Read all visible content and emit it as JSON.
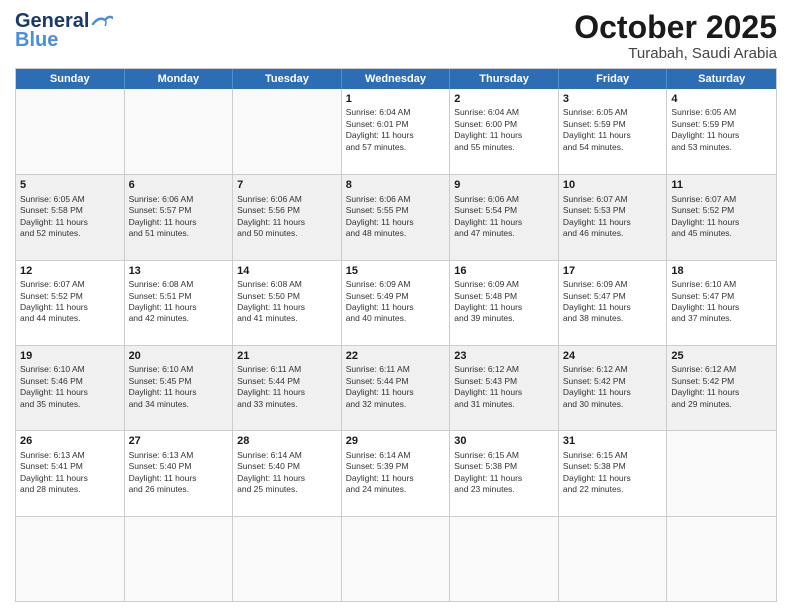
{
  "header": {
    "logo_line1": "General",
    "logo_line2": "Blue",
    "month": "October 2025",
    "location": "Turabah, Saudi Arabia"
  },
  "weekdays": [
    "Sunday",
    "Monday",
    "Tuesday",
    "Wednesday",
    "Thursday",
    "Friday",
    "Saturday"
  ],
  "rows": [
    [
      {
        "day": "",
        "text": ""
      },
      {
        "day": "",
        "text": ""
      },
      {
        "day": "",
        "text": ""
      },
      {
        "day": "1",
        "text": "Sunrise: 6:04 AM\nSunset: 6:01 PM\nDaylight: 11 hours\nand 57 minutes."
      },
      {
        "day": "2",
        "text": "Sunrise: 6:04 AM\nSunset: 6:00 PM\nDaylight: 11 hours\nand 55 minutes."
      },
      {
        "day": "3",
        "text": "Sunrise: 6:05 AM\nSunset: 5:59 PM\nDaylight: 11 hours\nand 54 minutes."
      },
      {
        "day": "4",
        "text": "Sunrise: 6:05 AM\nSunset: 5:59 PM\nDaylight: 11 hours\nand 53 minutes."
      }
    ],
    [
      {
        "day": "5",
        "text": "Sunrise: 6:05 AM\nSunset: 5:58 PM\nDaylight: 11 hours\nand 52 minutes."
      },
      {
        "day": "6",
        "text": "Sunrise: 6:06 AM\nSunset: 5:57 PM\nDaylight: 11 hours\nand 51 minutes."
      },
      {
        "day": "7",
        "text": "Sunrise: 6:06 AM\nSunset: 5:56 PM\nDaylight: 11 hours\nand 50 minutes."
      },
      {
        "day": "8",
        "text": "Sunrise: 6:06 AM\nSunset: 5:55 PM\nDaylight: 11 hours\nand 48 minutes."
      },
      {
        "day": "9",
        "text": "Sunrise: 6:06 AM\nSunset: 5:54 PM\nDaylight: 11 hours\nand 47 minutes."
      },
      {
        "day": "10",
        "text": "Sunrise: 6:07 AM\nSunset: 5:53 PM\nDaylight: 11 hours\nand 46 minutes."
      },
      {
        "day": "11",
        "text": "Sunrise: 6:07 AM\nSunset: 5:52 PM\nDaylight: 11 hours\nand 45 minutes."
      }
    ],
    [
      {
        "day": "12",
        "text": "Sunrise: 6:07 AM\nSunset: 5:52 PM\nDaylight: 11 hours\nand 44 minutes."
      },
      {
        "day": "13",
        "text": "Sunrise: 6:08 AM\nSunset: 5:51 PM\nDaylight: 11 hours\nand 42 minutes."
      },
      {
        "day": "14",
        "text": "Sunrise: 6:08 AM\nSunset: 5:50 PM\nDaylight: 11 hours\nand 41 minutes."
      },
      {
        "day": "15",
        "text": "Sunrise: 6:09 AM\nSunset: 5:49 PM\nDaylight: 11 hours\nand 40 minutes."
      },
      {
        "day": "16",
        "text": "Sunrise: 6:09 AM\nSunset: 5:48 PM\nDaylight: 11 hours\nand 39 minutes."
      },
      {
        "day": "17",
        "text": "Sunrise: 6:09 AM\nSunset: 5:47 PM\nDaylight: 11 hours\nand 38 minutes."
      },
      {
        "day": "18",
        "text": "Sunrise: 6:10 AM\nSunset: 5:47 PM\nDaylight: 11 hours\nand 37 minutes."
      }
    ],
    [
      {
        "day": "19",
        "text": "Sunrise: 6:10 AM\nSunset: 5:46 PM\nDaylight: 11 hours\nand 35 minutes."
      },
      {
        "day": "20",
        "text": "Sunrise: 6:10 AM\nSunset: 5:45 PM\nDaylight: 11 hours\nand 34 minutes."
      },
      {
        "day": "21",
        "text": "Sunrise: 6:11 AM\nSunset: 5:44 PM\nDaylight: 11 hours\nand 33 minutes."
      },
      {
        "day": "22",
        "text": "Sunrise: 6:11 AM\nSunset: 5:44 PM\nDaylight: 11 hours\nand 32 minutes."
      },
      {
        "day": "23",
        "text": "Sunrise: 6:12 AM\nSunset: 5:43 PM\nDaylight: 11 hours\nand 31 minutes."
      },
      {
        "day": "24",
        "text": "Sunrise: 6:12 AM\nSunset: 5:42 PM\nDaylight: 11 hours\nand 30 minutes."
      },
      {
        "day": "25",
        "text": "Sunrise: 6:12 AM\nSunset: 5:42 PM\nDaylight: 11 hours\nand 29 minutes."
      }
    ],
    [
      {
        "day": "26",
        "text": "Sunrise: 6:13 AM\nSunset: 5:41 PM\nDaylight: 11 hours\nand 28 minutes."
      },
      {
        "day": "27",
        "text": "Sunrise: 6:13 AM\nSunset: 5:40 PM\nDaylight: 11 hours\nand 26 minutes."
      },
      {
        "day": "28",
        "text": "Sunrise: 6:14 AM\nSunset: 5:40 PM\nDaylight: 11 hours\nand 25 minutes."
      },
      {
        "day": "29",
        "text": "Sunrise: 6:14 AM\nSunset: 5:39 PM\nDaylight: 11 hours\nand 24 minutes."
      },
      {
        "day": "30",
        "text": "Sunrise: 6:15 AM\nSunset: 5:38 PM\nDaylight: 11 hours\nand 23 minutes."
      },
      {
        "day": "31",
        "text": "Sunrise: 6:15 AM\nSunset: 5:38 PM\nDaylight: 11 hours\nand 22 minutes."
      },
      {
        "day": "",
        "text": ""
      }
    ],
    [
      {
        "day": "",
        "text": ""
      },
      {
        "day": "",
        "text": ""
      },
      {
        "day": "",
        "text": ""
      },
      {
        "day": "",
        "text": ""
      },
      {
        "day": "",
        "text": ""
      },
      {
        "day": "",
        "text": ""
      },
      {
        "day": "",
        "text": ""
      }
    ]
  ]
}
